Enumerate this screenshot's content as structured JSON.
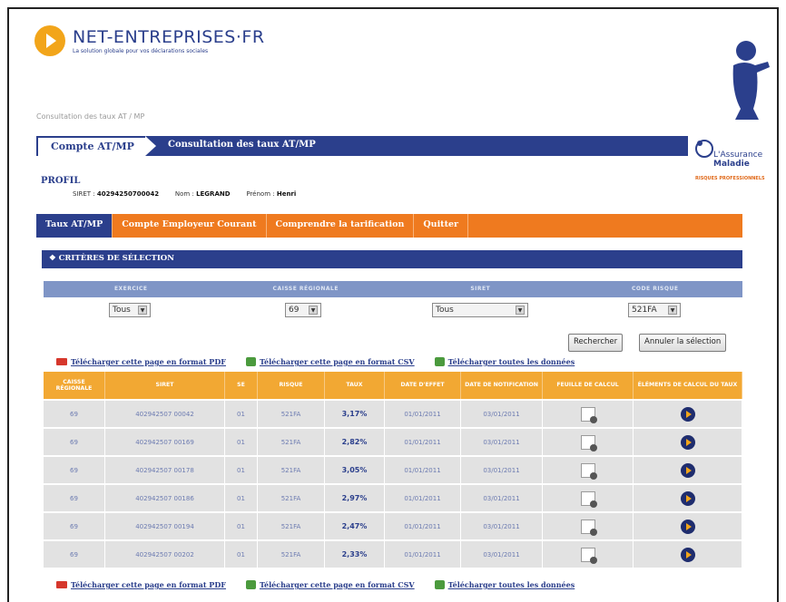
{
  "site": {
    "logo_text": "NET-ENTREPRISES·FR",
    "logo_tagline": "La solution globale pour vos déclarations sociales"
  },
  "breadcrumb": "Consultation des taux AT / MP",
  "tabs": {
    "active_label": "Compte AT/MP",
    "page_title": "Consultation des taux AT/MP"
  },
  "partner_logo": {
    "line1": "L'Assurance",
    "line2": "Maladie",
    "line3": "RISQUES PROFESSIONNELS"
  },
  "profil": {
    "heading": "PROFIL",
    "siret_label": "SIRET :",
    "siret_value": "40294250700042",
    "nom_label": "Nom :",
    "nom_value": "LEGRAND",
    "prenom_label": "Prénom :",
    "prenom_value": "Henri"
  },
  "nav": [
    {
      "label": "Taux AT/MP",
      "active": true
    },
    {
      "label": "Compte Employeur Courant",
      "active": false
    },
    {
      "label": "Comprendre la tarification",
      "active": false
    },
    {
      "label": "Quitter",
      "active": false
    }
  ],
  "criteria": {
    "title": "CRITÈRES DE SÉLECTION",
    "columns": [
      "EXERCICE",
      "CAISSE RÉGIONALE",
      "SIRET",
      "CODE RISQUE"
    ],
    "values": [
      "Tous",
      "69",
      "Tous",
      "521FA"
    ]
  },
  "buttons": {
    "search": "Rechercher",
    "cancel": "Annuler la sélection"
  },
  "downloads": {
    "pdf": "Télécharger cette page en format PDF",
    "csv": "Télécharger cette page en format CSV",
    "all": "Télécharger toutes les données"
  },
  "table": {
    "headers": [
      "CAISSE RÉGIONALE",
      "SIRET",
      "SE",
      "RISQUE",
      "TAUX",
      "DATE D'EFFET",
      "DATE DE NOTIFICATION",
      "FEUILLE DE CALCUL",
      "ÉLÉMENTS DE CALCUL DU TAUX"
    ],
    "rows": [
      {
        "caisse": "69",
        "siret": "402942507 00042",
        "se": "01",
        "risque": "521FA",
        "taux": "3,17%",
        "effet": "01/01/2011",
        "notif": "03/01/2011"
      },
      {
        "caisse": "69",
        "siret": "402942507 00169",
        "se": "01",
        "risque": "521FA",
        "taux": "2,82%",
        "effet": "01/01/2011",
        "notif": "03/01/2011"
      },
      {
        "caisse": "69",
        "siret": "402942507 00178",
        "se": "01",
        "risque": "521FA",
        "taux": "3,05%",
        "effet": "01/01/2011",
        "notif": "03/01/2011"
      },
      {
        "caisse": "69",
        "siret": "402942507 00186",
        "se": "01",
        "risque": "521FA",
        "taux": "2,97%",
        "effet": "01/01/2011",
        "notif": "03/01/2011"
      },
      {
        "caisse": "69",
        "siret": "402942507 00194",
        "se": "01",
        "risque": "521FA",
        "taux": "2,47%",
        "effet": "01/01/2011",
        "notif": "03/01/2011"
      },
      {
        "caisse": "69",
        "siret": "402942507 00202",
        "se": "01",
        "risque": "521FA",
        "taux": "2,33%",
        "effet": "01/01/2011",
        "notif": "03/01/2011"
      }
    ]
  },
  "colors": {
    "brand_blue": "#2b3f8c",
    "brand_orange": "#ef7a1f",
    "header_orange": "#f2a833"
  }
}
